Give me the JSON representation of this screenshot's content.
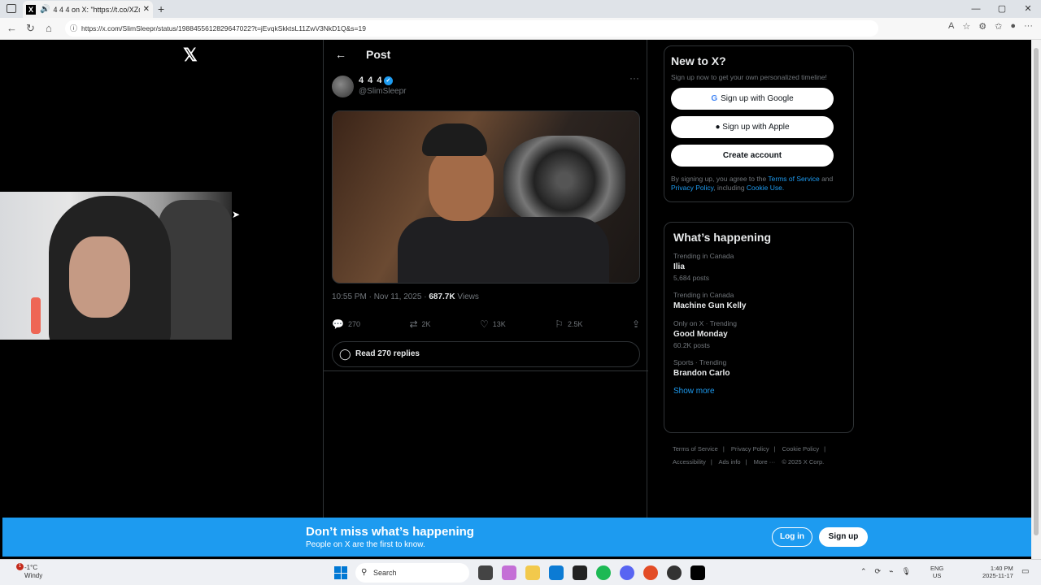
{
  "browser": {
    "tab_title": "4 4 4 on X: \"https://t.co/XZd",
    "new_tab": "+",
    "url": "https://x.com/SlimSleepr/status/1988455612829647022?t=jEvqkSkktsL11ZwV3NkD1Q&s=19",
    "window_controls": [
      "—",
      "▢",
      "✕"
    ]
  },
  "x_logo": "𝕏",
  "post": {
    "header": "Post",
    "display_name": "4 4 4",
    "handle": "@SlimSleepr",
    "timestamp": "10:55 PM · Nov 11, 2025 · ",
    "views": "687.7K",
    "views_label": " Views",
    "replies": "270",
    "reposts": "2K",
    "likes": "13K",
    "bookmarks": "2.5K",
    "read_replies": "Read 270 replies"
  },
  "signup_box": {
    "title": "New to X?",
    "subtitle": "Sign up now to get your own personalized timeline!",
    "google": "Sign up with Google",
    "apple": "Sign up with Apple",
    "create": "Create account",
    "terms_pre": "By signing up, you agree to the ",
    "terms_link": "Terms of Service",
    "terms_and": " and ",
    "privacy_link": "Privacy Policy",
    "terms_incl": ", including ",
    "cookie_link": "Cookie Use."
  },
  "happening": {
    "title": "What’s happening",
    "trends": [
      {
        "context": "Trending in Canada",
        "name": "Ilia",
        "count": "5,684 posts"
      },
      {
        "context": "Trending in Canada",
        "name": "Machine Gun Kelly",
        "count": ""
      },
      {
        "context": "Only on X · Trending",
        "name": "Good Monday",
        "count": "60.2K posts"
      },
      {
        "context": "Sports · Trending",
        "name": "Brandon Carlo",
        "count": ""
      }
    ],
    "show_more": "Show more"
  },
  "footer_links": [
    "Terms of Service",
    "|",
    "Privacy Policy",
    "|",
    "Cookie Policy",
    "|",
    "Accessibility",
    "|",
    "Ads info",
    "|",
    "More ···",
    "© 2025 X Corp."
  ],
  "banner": {
    "title": "Don’t miss what’s happening",
    "subtitle": "People on X are the first to know.",
    "login": "Log in",
    "signup": "Sign up"
  },
  "taskbar": {
    "weather_temp": "-1°C",
    "weather_desc": "Windy",
    "weather_badge": "1",
    "search": "Search",
    "lang_1": "ENG",
    "lang_2": "US",
    "time": "1:40 PM",
    "date": "2025-11-17"
  }
}
